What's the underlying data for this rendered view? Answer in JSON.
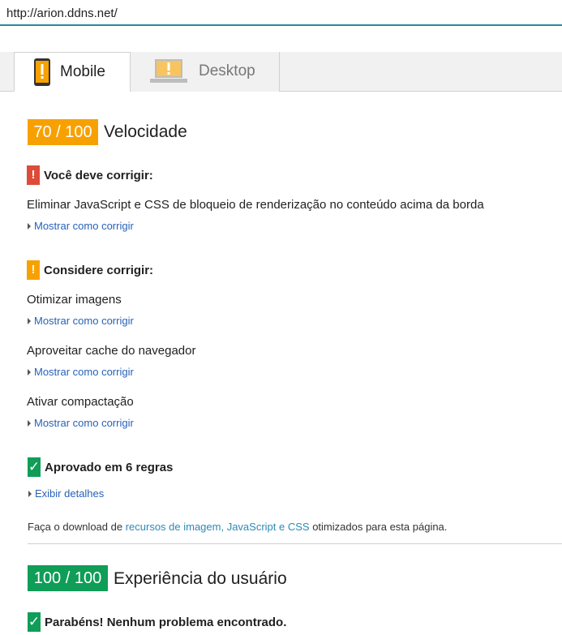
{
  "url": "http://arion.ddns.net/",
  "tabs": [
    {
      "label": "Mobile",
      "selected": true,
      "icon": "phone-warning-icon"
    },
    {
      "label": "Desktop",
      "selected": false,
      "icon": "laptop-warning-icon"
    }
  ],
  "speed": {
    "score": "70 / 100",
    "title": "Velocidade",
    "score_color": "#f7a100",
    "must_fix": {
      "badge": "!",
      "heading": "Você deve corrigir:",
      "items": [
        {
          "text": "Eliminar JavaScript e CSS de bloqueio de renderização no conteúdo acima da borda",
          "link": "Mostrar como corrigir"
        }
      ]
    },
    "consider_fix": {
      "badge": "!",
      "heading": "Considere corrigir:",
      "items": [
        {
          "text": "Otimizar imagens",
          "link": "Mostrar como corrigir"
        },
        {
          "text": "Aproveitar cache do navegador",
          "link": "Mostrar como corrigir"
        },
        {
          "text": "Ativar compactação",
          "link": "Mostrar como corrigir"
        }
      ]
    },
    "passed": {
      "badge": "✓",
      "heading": "Aprovado em 6 regras",
      "link": "Exibir detalhes"
    },
    "download": {
      "prefix": "Faça o download de ",
      "link": "recursos de imagem, JavaScript e CSS",
      "suffix": " otimizados para esta página."
    }
  },
  "ux": {
    "score": "100 / 100",
    "title": "Experiência do usuário",
    "score_color": "#0f9d58",
    "passed": {
      "badge": "✓",
      "heading": "Parabéns! Nenhum problema encontrado."
    }
  }
}
